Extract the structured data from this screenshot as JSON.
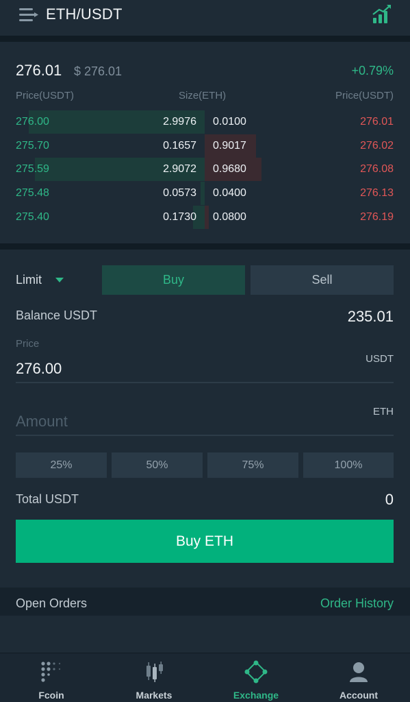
{
  "header": {
    "title": "ETH/USDT"
  },
  "ticker": {
    "last_price": "276.01",
    "last_usd": "$ 276.01",
    "change": "+0.79%"
  },
  "orderbook": {
    "headers": {
      "bid_price": "Price(USDT)",
      "size": "Size(ETH)",
      "ask_price": "Price(USDT)"
    },
    "rows": [
      {
        "bid_price": "276.00",
        "bid_size": "2.9976",
        "ask_size": "0.0100",
        "ask_price": "276.01",
        "bid_depth": 0.93,
        "ask_depth": 0.0
      },
      {
        "bid_price": "275.70",
        "bid_size": "0.1657",
        "ask_size": "0.9017",
        "ask_price": "276.02",
        "bid_depth": 0.0,
        "ask_depth": 0.27
      },
      {
        "bid_price": "275.59",
        "bid_size": "2.9072",
        "ask_size": "0.9680",
        "ask_price": "276.08",
        "bid_depth": 0.9,
        "ask_depth": 0.3
      },
      {
        "bid_price": "275.48",
        "bid_size": "0.0573",
        "ask_size": "0.0400",
        "ask_price": "276.13",
        "bid_depth": 0.02,
        "ask_depth": 0.0
      },
      {
        "bid_price": "275.40",
        "bid_size": "0.1730",
        "ask_size": "0.0800",
        "ask_price": "276.19",
        "bid_depth": 0.06,
        "ask_depth": 0.02
      }
    ]
  },
  "order_form": {
    "order_type": "Limit",
    "tab_buy": "Buy",
    "tab_sell": "Sell",
    "balance_label": "Balance USDT",
    "balance_value": "235.01",
    "price_label": "Price",
    "price_unit": "USDT",
    "price_value": "276.00",
    "amount_placeholder": "Amount",
    "amount_unit": "ETH",
    "percent_buttons": [
      "25%",
      "50%",
      "75%",
      "100%"
    ],
    "total_label": "Total USDT",
    "total_value": "0",
    "submit_label": "Buy ETH"
  },
  "orders": {
    "open_orders": "Open Orders",
    "order_history": "Order History"
  },
  "bottom_nav": {
    "items": [
      {
        "label": "Fcoin",
        "icon": "fcoin-dots-icon",
        "active": false
      },
      {
        "label": "Markets",
        "icon": "candlestick-icon",
        "active": false
      },
      {
        "label": "Exchange",
        "icon": "exchange-icon",
        "active": true
      },
      {
        "label": "Account",
        "icon": "user-icon",
        "active": false
      }
    ]
  },
  "colors": {
    "accent_green": "#02b17c",
    "bid_green": "#2fb888",
    "ask_red": "#e25757",
    "background": "#1e2b36"
  }
}
